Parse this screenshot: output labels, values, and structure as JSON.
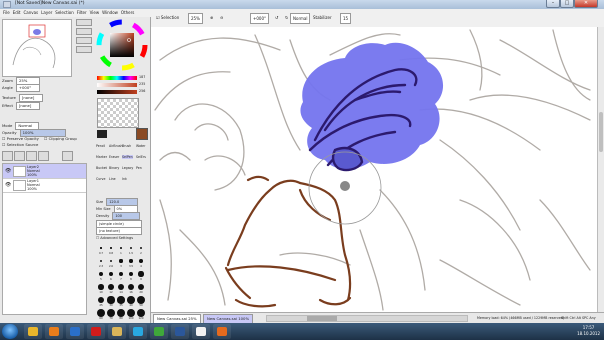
{
  "window": {
    "title": "[Not Saved]New Canvas.sai (*)",
    "buttons": {
      "minimize": "–",
      "maximize": "□",
      "close": "✕"
    }
  },
  "menubar": {
    "items": [
      "File",
      "Edit",
      "Canvas",
      "Layer",
      "Selection",
      "Filter",
      "View",
      "Window",
      "Others"
    ]
  },
  "toolbar": {
    "selection_label": "Selection",
    "zoom": "25%",
    "angle": "+000°",
    "mode": "Normal",
    "stabilizer_label": "Stabilizer",
    "stabilizer_value": "15"
  },
  "navigator": {
    "zoom_label": "Zoom",
    "zoom_value": "25%",
    "angle_label": "Angle",
    "angle_value": "+000°"
  },
  "color": {
    "accent": "#c04020",
    "sliders": [
      "H",
      "S",
      "V"
    ],
    "values": [
      "187",
      "235",
      "256"
    ]
  },
  "left_panel": {
    "texture_label": "Texture",
    "texture_value": "[none]",
    "effect_label": "Effect",
    "effect_value": "[none]",
    "mode_label": "Mode",
    "mode_value": "Normal",
    "opacity_label": "Opacity",
    "opacity_value": "100%",
    "preserve_opacity": "Preserve Opacity",
    "clipping_group": "Clipping Group",
    "selection_source": "Selection Source"
  },
  "layers": [
    {
      "name": "Layer2",
      "mode": "Normal",
      "opacity": "100%"
    },
    {
      "name": "Layer1",
      "mode": "Normal",
      "opacity": "100%"
    }
  ],
  "tools": {
    "row1": [
      "Pencil",
      "AirBrush",
      "Brush",
      "Water"
    ],
    "row2": [
      "Marker",
      "Eraser",
      "SelPen",
      "SelErs"
    ],
    "row3": [
      "Bucket",
      "Binary",
      "Legacy",
      "Pen"
    ],
    "row4": [
      "Curve",
      "Line",
      "Ink"
    ]
  },
  "brush": {
    "size_label": "Size",
    "size_value": "120.0",
    "min_size_label": "Min Size",
    "min_size_value": "0%",
    "density_label": "Density",
    "density_value": "100",
    "shape": "(simple circle)",
    "texture": "(no texture)",
    "advanced": "Advanced Settings"
  },
  "brush_sizes": [
    "0.7",
    "0.8",
    "1",
    "1.5",
    "2",
    "2.3",
    "2.6",
    "3",
    "3.5",
    "4",
    "5",
    "6",
    "7",
    "8",
    "9",
    "10",
    "12",
    "14",
    "16",
    "20",
    "25",
    "30",
    "35",
    "40",
    "50",
    "60",
    "70",
    "80",
    "100",
    "120"
  ],
  "status": {
    "tabs": [
      {
        "name": "New Canvas.sai",
        "zoom": "25%"
      },
      {
        "name": "New Canvas.sai",
        "zoom": "100%"
      }
    ],
    "memory": "Memory load: 64% (466MB used / 1229MB reserved)",
    "keys": "Shift Ctrl Alt SPC Any"
  },
  "taskbar": {
    "time": "17:57",
    "date": "18.10.2012",
    "icons": [
      {
        "name": "chrome-icon",
        "color": "#e8b62c"
      },
      {
        "name": "avast-icon",
        "color": "#e87d1c"
      },
      {
        "name": "media-player-icon",
        "color": "#2a6fc9"
      },
      {
        "name": "opera-icon",
        "color": "#d11c1c"
      },
      {
        "name": "explorer-icon",
        "color": "#d9b55a"
      },
      {
        "name": "skype-icon",
        "color": "#29a8e0"
      },
      {
        "name": "utorrent-icon",
        "color": "#3fa83a"
      },
      {
        "name": "word-icon",
        "color": "#2b579a"
      },
      {
        "name": "sai-icon",
        "color": "#f2f2f2"
      },
      {
        "name": "firefox-icon",
        "color": "#e56a1e"
      }
    ]
  }
}
